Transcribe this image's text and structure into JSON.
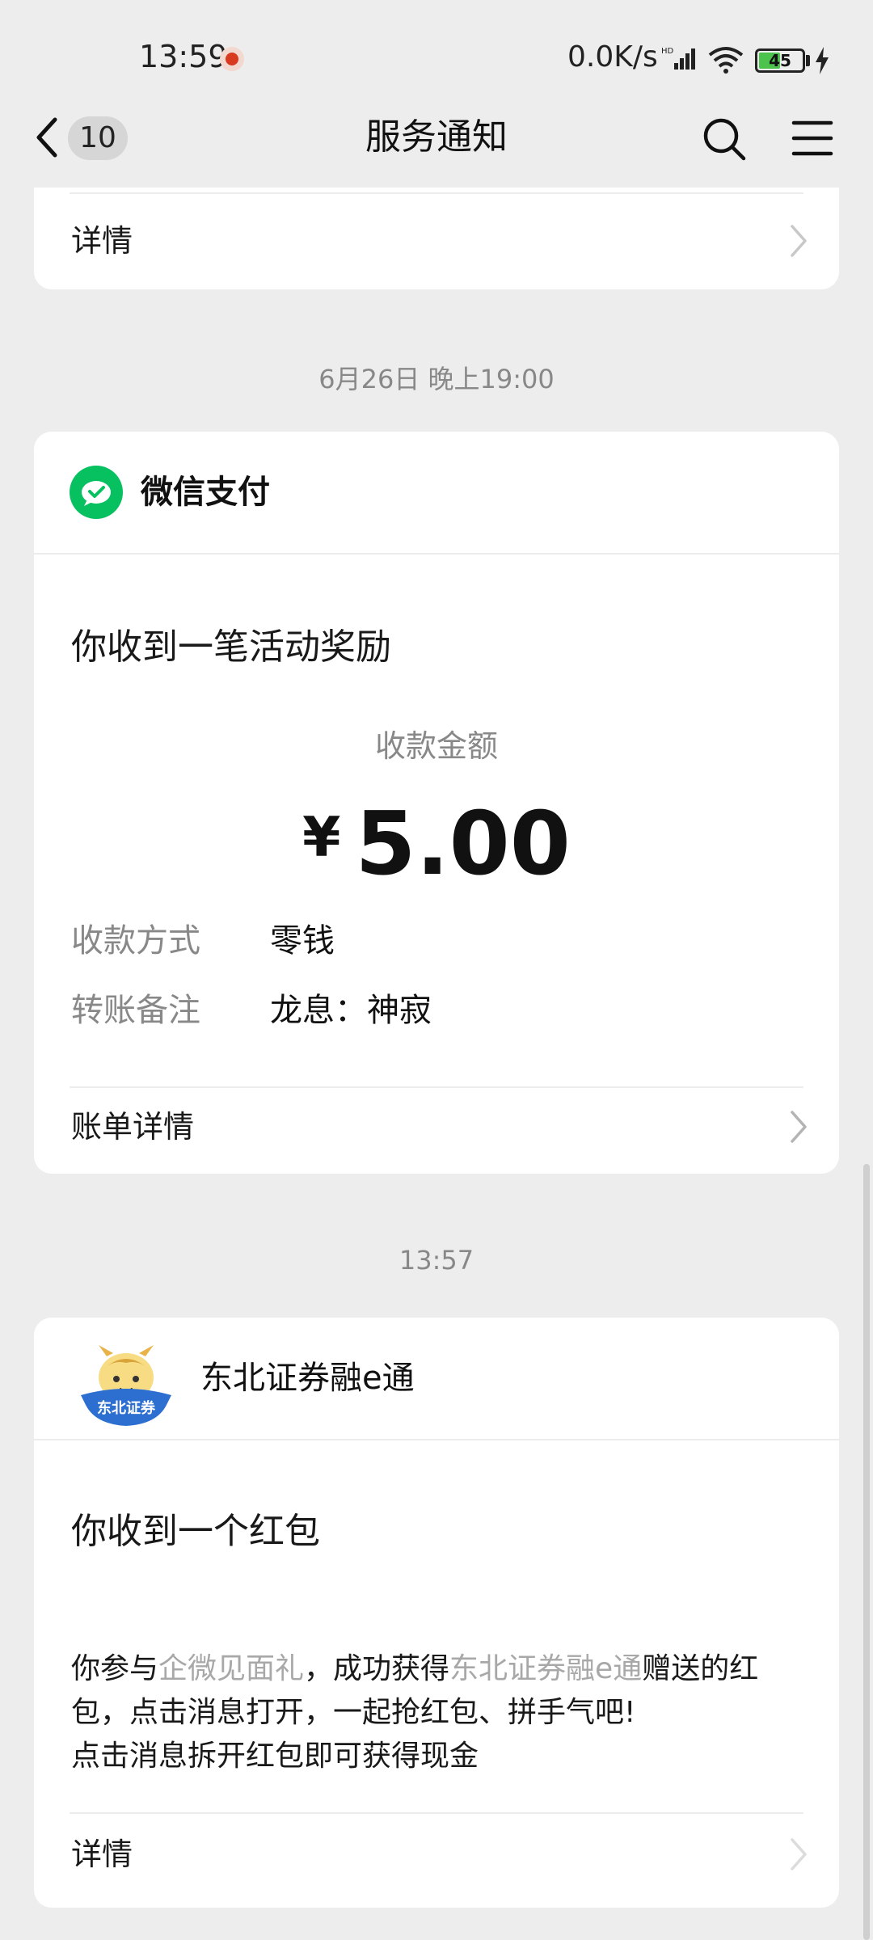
{
  "status_bar": {
    "time": "13:59",
    "net_speed": "0.0K/s",
    "battery": "45"
  },
  "nav": {
    "unread_count": "10",
    "title": "服务通知"
  },
  "top_card": {
    "detail_label": "详情"
  },
  "timestamps": {
    "first": "6月26日 晚上19:00",
    "second": "13:57"
  },
  "wechat_pay_card": {
    "app_name": "微信支付",
    "title": "你收到一笔活动奖励",
    "amount_label": "收款金额",
    "currency": "¥",
    "amount": "5.00",
    "method_label": "收款方式",
    "method_value": "零钱",
    "remark_label": "转账备注",
    "remark_value": "龙息：神寂",
    "bill_detail_label": "账单详情"
  },
  "securities_card": {
    "app_name": "东北证券融e通",
    "logo_text": "东北证券",
    "title": "你收到一个红包",
    "body_part1": "你参与",
    "body_link1": "企微见面礼",
    "body_part2": "，成功获得",
    "body_link2": "东北证券融e通",
    "body_part3": "赠送的红包，点击消息打开，一起抢红包、拼手气吧!",
    "body_line3": "点击消息拆开红包即可获得现金",
    "detail_label": "详情"
  },
  "colors": {
    "background": "#ededed",
    "card": "#ffffff",
    "wechat_green": "#07c160",
    "muted_text": "#888888",
    "link_gray": "#a8a8a8"
  },
  "icons": [
    "back-arrow-icon",
    "search-icon",
    "menu-icon",
    "wechat-pay-icon",
    "chevron-right-icon",
    "wifi-icon",
    "signal-icon",
    "battery-icon",
    "charging-icon"
  ]
}
